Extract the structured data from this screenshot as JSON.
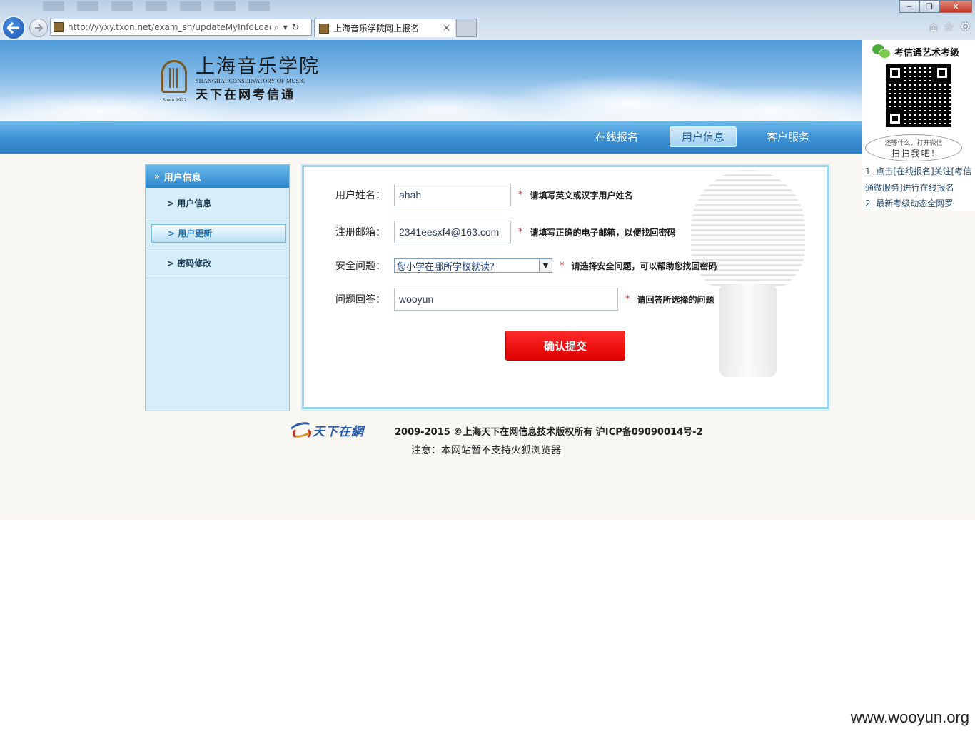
{
  "browser": {
    "address_url": "http://yyxy.txon.net/exam_sh/updateMyInfoLoad.a",
    "tab_title": "上海音乐学院网上报名",
    "tab_close": "×",
    "window_buttons": [
      "─",
      "❐",
      "✕"
    ],
    "right_icons": [
      "home-icon",
      "star-icon",
      "gear-icon"
    ]
  },
  "header": {
    "logo_cn": "上海音乐学院",
    "logo_en": "SHANGHAI CONSERVATORY OF MUSIC",
    "logo_since": "Since 1927",
    "logo_sub": "天下在网考信通"
  },
  "nav": {
    "items": [
      {
        "label": "在线报名"
      },
      {
        "label": "用户信息"
      },
      {
        "label": "客户服务"
      }
    ],
    "active_index": 1
  },
  "sidebar": {
    "heading": "用户信息",
    "items": [
      {
        "label": "> 用户信息"
      },
      {
        "label": "> 用户更新"
      },
      {
        "label": "> 密码修改"
      }
    ],
    "active_index": 1
  },
  "form": {
    "username": {
      "label": "用户姓名：",
      "value": "ahah",
      "required": "*",
      "hint": "请填写英文或汉字用户姓名"
    },
    "email": {
      "label": "注册邮箱：",
      "value": "2341eesxf4@163.com",
      "required": "*",
      "hint": "请填写正确的电子邮箱，以便找回密码"
    },
    "security_question": {
      "label": "安全问题：",
      "selected": "您小学在哪所学校就读?",
      "required": "*",
      "hint": "请选择安全问题，可以帮助您找回密码"
    },
    "answer": {
      "label": "问题回答：",
      "value": "wooyun",
      "required": "*",
      "hint": "请回答所选择的问题"
    },
    "submit_label": "确认提交"
  },
  "footer": {
    "logo_text": "天下在網",
    "copyright": "2009-2015 ©上海天下在网信息技术版权所有 沪ICP备09090014号-2",
    "notice": "注意：本网站暂不支持火狐浏览器"
  },
  "qr_panel": {
    "title": "考信通艺术考级",
    "bubble_line1": "还等什么，打开微信",
    "bubble_line2": "扫扫我吧!",
    "items": [
      "1. 点击[在线报名]关注[考信通微服务]进行在线报名",
      "2. 最新考级动态全网罗"
    ]
  },
  "watermark": "www.wooyun.org",
  "colors": {
    "nav_blue": "#3a8fd3",
    "submit_red": "#e00000",
    "sidebar_bg": "#d5eef9",
    "panel_border": "#9dd5f3"
  }
}
